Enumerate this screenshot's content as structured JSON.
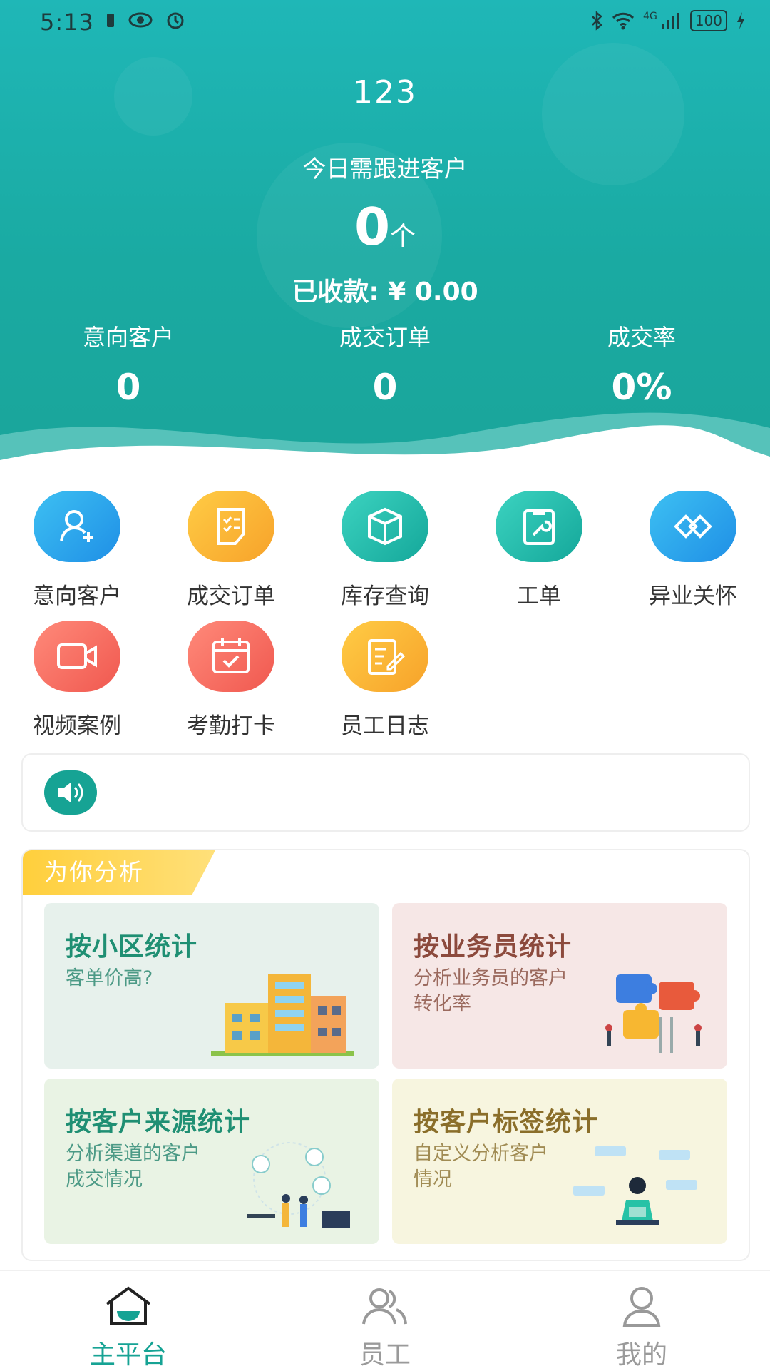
{
  "status_bar": {
    "time": "5:13",
    "network": "4G",
    "battery": "100"
  },
  "header": {
    "company": "123",
    "today_label": "今日需跟进客户",
    "today_count": "0",
    "today_unit": "个",
    "received": "已收款: ¥ 0.00",
    "stats": [
      {
        "label": "意向客户",
        "value": "0"
      },
      {
        "label": "成交订单",
        "value": "0"
      },
      {
        "label": "成交率",
        "value": "0%"
      }
    ]
  },
  "menu": {
    "items": [
      {
        "label": "意向客户",
        "icon": "add-user-icon",
        "color": "#2aa8ee"
      },
      {
        "label": "成交订单",
        "icon": "order-form-icon",
        "color": "#f9b634"
      },
      {
        "label": "库存查询",
        "icon": "box-icon",
        "color": "#1fb8a8"
      },
      {
        "label": "工单",
        "icon": "wrench-clipboard-icon",
        "color": "#1fb8a8"
      },
      {
        "label": "异业关怀",
        "icon": "diamond-link-icon",
        "color": "#2aa8ee"
      },
      {
        "label": "视频案例",
        "icon": "video-camera-icon",
        "color": "#f46b5e"
      },
      {
        "label": "考勤打卡",
        "icon": "calendar-check-icon",
        "color": "#f46b5e"
      },
      {
        "label": "员工日志",
        "icon": "notebook-pen-icon",
        "color": "#f9b634"
      }
    ]
  },
  "notice": {
    "icon": "speaker-icon"
  },
  "analysis": {
    "tag": "为你分析",
    "cards": [
      {
        "title": "按小区统计",
        "subtitle": "客单价高?"
      },
      {
        "title": "按业务员统计",
        "subtitle": "分析业务员的客户\n转化率"
      },
      {
        "title": "按客户来源统计",
        "subtitle": "分析渠道的客户\n成交情况"
      },
      {
        "title": "按客户标签统计",
        "subtitle": "自定义分析客户\n情况"
      }
    ]
  },
  "tabbar": {
    "tabs": [
      {
        "label": "主平台",
        "icon": "home-icon",
        "active": true
      },
      {
        "label": "员工",
        "icon": "group-icon",
        "active": false
      },
      {
        "label": "我的",
        "icon": "person-icon",
        "active": false
      }
    ]
  },
  "theme": {
    "primary": "#16a394",
    "hero_top": "#1fb7b7",
    "accent_yellow": "#ffcf3c"
  }
}
